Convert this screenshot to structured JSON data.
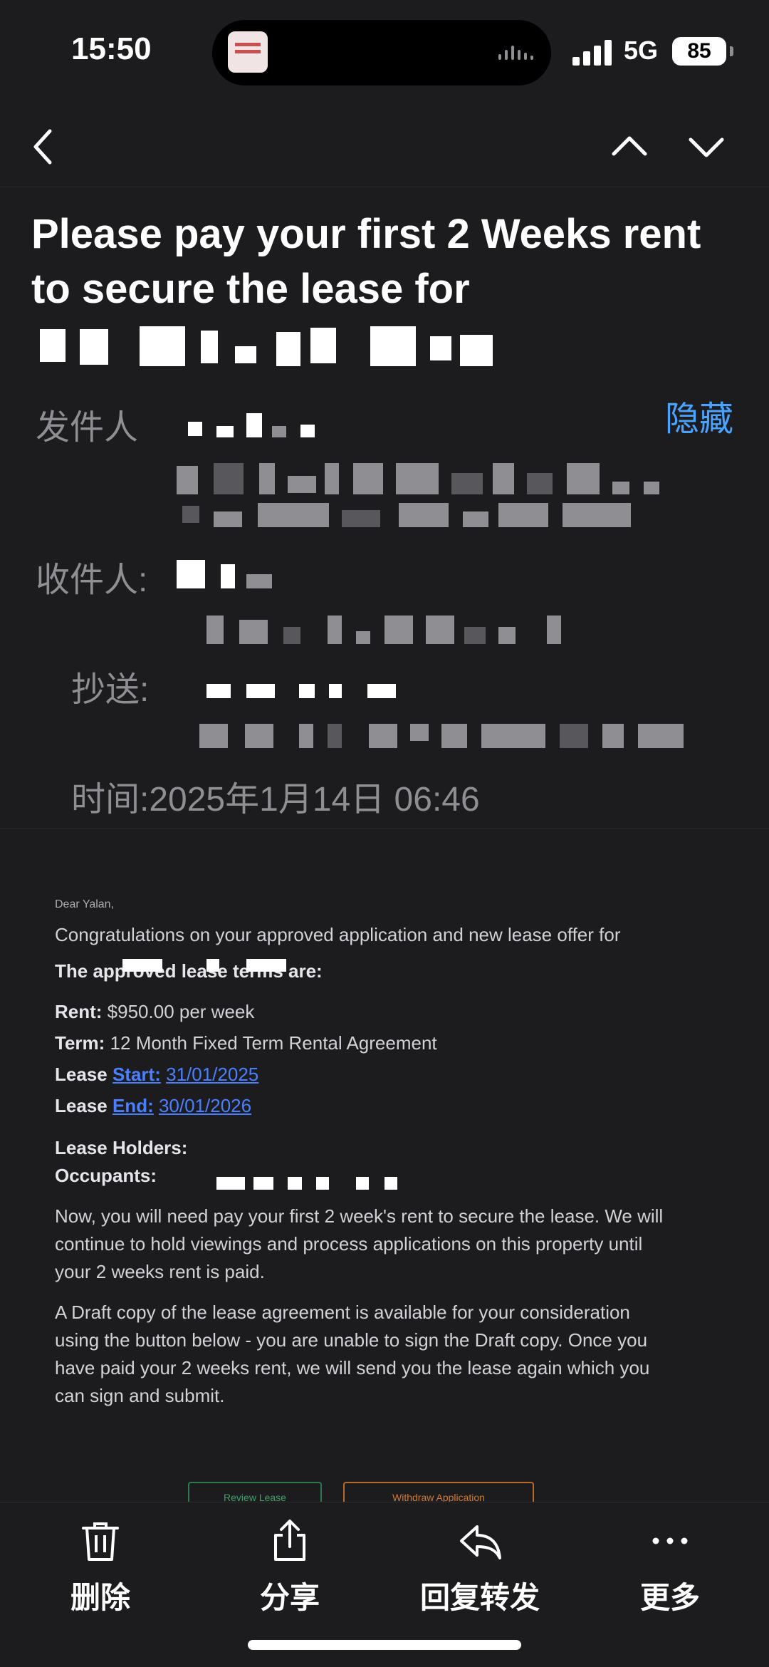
{
  "status_bar": {
    "time": "15:50",
    "network": "5G",
    "battery": "85"
  },
  "email": {
    "subject": "Please pay your first 2 Weeks rent to secure the lease for",
    "labels": {
      "from": "发件人",
      "to": "收件人:",
      "cc": "抄送:",
      "time": "时间:"
    },
    "hide_label": "隐藏",
    "datetime": "2025年1月14日 06:46"
  },
  "body": {
    "greeting": "Dear Yalan,",
    "intro": "Congratulations on your approved application and new lease offer for",
    "terms_heading": "The approved lease terms are:",
    "rent_label": "Rent:",
    "rent_value": "$950.00 per week",
    "term_label": "Term:",
    "term_value": "12 Month Fixed Term Rental Agreement",
    "lease_word": "Lease",
    "start_label": "Start:",
    "start_date": "31/01/2025",
    "end_label": "End:",
    "end_date": "30/01/2026",
    "holders_label": "Lease Holders:",
    "occupants_label": "Occupants:",
    "para1": "Now, you will need pay your first 2 week's rent to secure the lease. We will continue to hold viewings and process applications on this property until your 2 weeks rent is paid.",
    "para2": "A Draft copy of the lease agreement is available for your consideration using the button below - you are unable to sign the Draft copy. Once you have paid your 2 weeks rent, we will send you the lease again which you can sign and submit.",
    "review_button": "Review Lease",
    "withdraw_button": "Withdraw Application"
  },
  "toolbar": {
    "delete": "删除",
    "share": "分享",
    "reply_forward": "回复转发",
    "more": "更多"
  },
  "colors": {
    "background": "#1c1c1e",
    "link": "#4a80ff",
    "hide_link": "#4aa3ff",
    "secondary_text": "#8e8e93"
  }
}
